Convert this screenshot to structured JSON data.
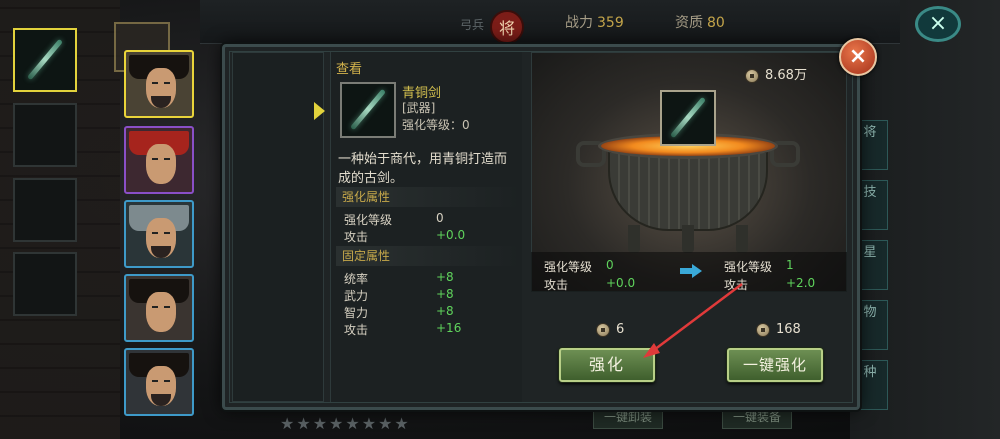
{
  "background": {
    "stats": {
      "power_label": "战力",
      "power_value": "359",
      "quality_label": "资质",
      "quality_value": "80"
    },
    "top_sub": "弓兵",
    "seal_text": "将",
    "close_glyph": "×",
    "stars": "★★★★★★★★",
    "bottom_buttons": [
      "一键卸装",
      "一键装备"
    ],
    "side_tabs": [
      "将",
      "技",
      "星",
      "物",
      "种"
    ]
  },
  "heroes": [
    "hero-1",
    "hero-2",
    "hero-3",
    "hero-4",
    "hero-5"
  ],
  "panel": {
    "close_glyph": "×",
    "view_title": "查看",
    "item": {
      "name": "青铜剑",
      "type": "[武器]",
      "level_text": "强化等级：0",
      "description": "一种始于商代，用青铜打造而成的古剑。"
    },
    "enhance_section": {
      "title": "强化属性",
      "rows": [
        {
          "label": "强化等级",
          "value": "0"
        },
        {
          "label": "攻击",
          "value": "+0.0"
        }
      ]
    },
    "fixed_section": {
      "title": "固定属性",
      "rows": [
        {
          "label": "统率",
          "value": "+8"
        },
        {
          "label": "武力",
          "value": "+8"
        },
        {
          "label": "智力",
          "value": "+8"
        },
        {
          "label": "攻击",
          "value": "+16"
        }
      ]
    },
    "forge": {
      "money": "8.68万",
      "current": {
        "level_label": "强化等级",
        "level_value": "0",
        "attack_label": "攻击",
        "attack_value": "+0.0"
      },
      "next": {
        "level_label": "强化等级",
        "level_value": "1",
        "attack_label": "攻击",
        "attack_value": "+2.0"
      },
      "cost_single": "6",
      "cost_auto": "168",
      "enhance_button": "强化",
      "auto_enhance_button": "一键强化"
    }
  },
  "colors": {
    "accent_gold": "#d3b34c",
    "green_value": "#5fd35c",
    "button_green": "#4f7040",
    "close_red": "#c2482a",
    "annotation_arrow": "#e03a3a"
  }
}
